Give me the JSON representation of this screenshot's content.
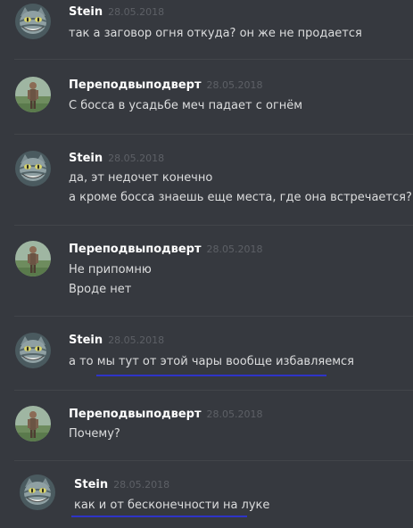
{
  "messages": [
    {
      "author": "Stein",
      "timestamp": "28.05.2018",
      "avatar": "cheshire-cat-avatar",
      "lines": [
        "так а заговор огня откуда? он же не продается"
      ]
    },
    {
      "author": "Переподвыподверт",
      "timestamp": "28.05.2018",
      "avatar": "figure-in-field-avatar",
      "lines": [
        "С босса в усадьбе меч падает с огнём"
      ]
    },
    {
      "author": "Stein",
      "timestamp": "28.05.2018",
      "avatar": "cheshire-cat-avatar",
      "lines": [
        "да, эт недочет конечно",
        "а кроме босса знаешь еще места, где она встречается?"
      ]
    },
    {
      "author": "Переподвыподверт",
      "timestamp": "28.05.2018",
      "avatar": "figure-in-field-avatar",
      "lines": [
        "Не припомню",
        "Вроде нет"
      ]
    },
    {
      "author": "Stein",
      "timestamp": "28.05.2018",
      "avatar": "cheshire-cat-avatar",
      "lines": [
        "а то мы тут от этой чары вообще избавляемся"
      ],
      "highlighted": true
    },
    {
      "author": "Переподвыподверт",
      "timestamp": "28.05.2018",
      "avatar": "figure-in-field-avatar",
      "lines": [
        "Почему?"
      ]
    },
    {
      "author": "Stein",
      "timestamp": "28.05.2018",
      "avatar": "cheshire-cat-avatar",
      "lines": [
        "как и от бесконечности на луке"
      ],
      "highlighted": true
    }
  ],
  "colors": {
    "background": "#36393f",
    "author": "#ffffff",
    "timestamp": "#5d6066",
    "text": "#dcddde",
    "divider": "#42454a",
    "underline": "#2e34c8"
  }
}
